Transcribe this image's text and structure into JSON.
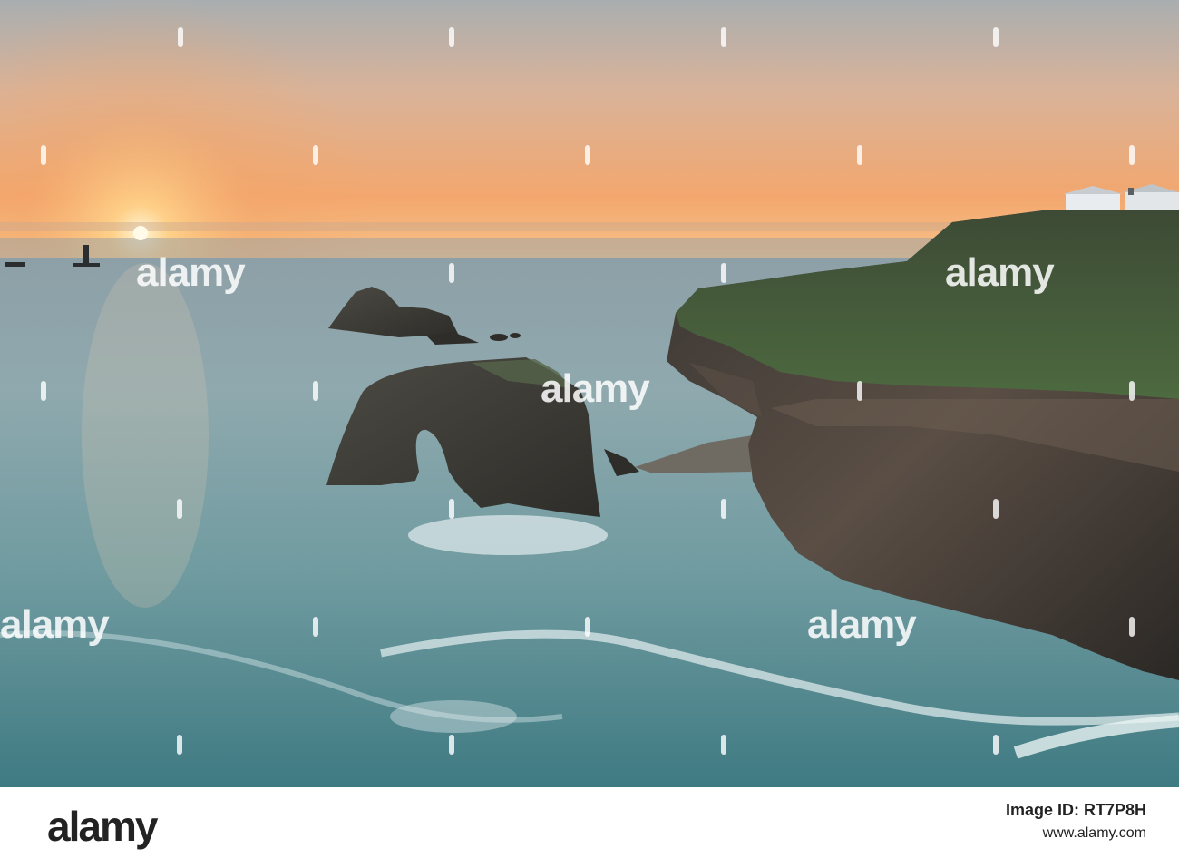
{
  "photo": {
    "description_label": "",
    "watermark_text": "alamy"
  },
  "footer": {
    "logo": "alamy",
    "image_id_line": "Image ID: RT7P8H",
    "site": "www.alamy.com"
  }
}
